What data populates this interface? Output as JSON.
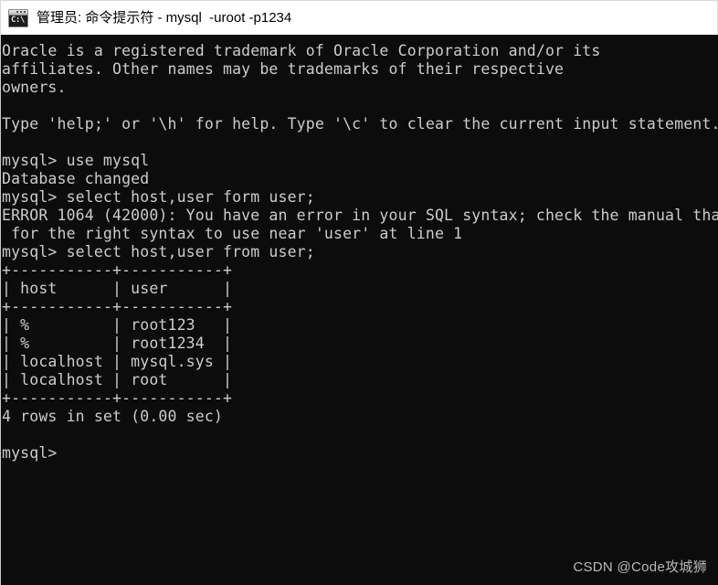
{
  "window": {
    "title": "管理员: 命令提示符 - mysql  -uroot -p1234",
    "icon_name": "cmd-icon",
    "icon_glyph": "C:\\",
    "titlebar_bg": "#ffffff",
    "terminal_bg": "#0c0c0c",
    "terminal_fg": "#cccccc"
  },
  "terminal": {
    "lines": [
      "Oracle is a registered trademark of Oracle Corporation and/or its",
      "affiliates. Other names may be trademarks of their respective",
      "owners.",
      "",
      "Type 'help;' or '\\h' for help. Type '\\c' to clear the current input statement.",
      "",
      "mysql> use mysql",
      "Database changed",
      "mysql> select host,user form user;",
      "ERROR 1064 (42000): You have an error in your SQL syntax; check the manual tha",
      " for the right syntax to use near 'user' at line 1",
      "mysql> select host,user from user;",
      "+-----------+-----------+",
      "| host      | user      |",
      "+-----------+-----------+",
      "| %         | root123   |",
      "| %         | root1234  |",
      "| localhost | mysql.sys |",
      "| localhost | root      |",
      "+-----------+-----------+",
      "4 rows in set (0.00 sec)",
      "",
      "mysql>"
    ],
    "result_table": {
      "columns": [
        "host",
        "user"
      ],
      "rows": [
        [
          "%",
          "root123"
        ],
        [
          "%",
          "root1234"
        ],
        [
          "localhost",
          "mysql.sys"
        ],
        [
          "localhost",
          "root"
        ]
      ],
      "row_count_text": "4 rows in set (0.00 sec)"
    },
    "commands": [
      "use mysql",
      "select host,user form user;",
      "select host,user from user;"
    ],
    "prompt": "mysql>",
    "error": {
      "code": "ERROR 1064 (42000)",
      "message": "You have an error in your SQL syntax; check the manual tha for the right syntax to use near 'user' at line 1"
    }
  },
  "watermark": {
    "text": "CSDN @Code攻城狮"
  }
}
